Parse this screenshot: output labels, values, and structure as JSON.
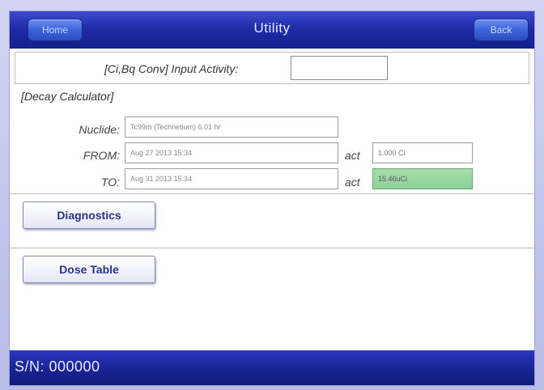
{
  "window": {
    "title": "Utility",
    "home_label": "Home",
    "back_label": "Back"
  },
  "conversion": {
    "label": "[Ci,Bq Conv] Input Activity:",
    "input_value": ""
  },
  "decay": {
    "section_title": "[Decay Calculator]",
    "nuclide_label": "Nuclide:",
    "nuclide_value": "Tc99m (Technetium) 6.01 hr",
    "from_label": "FROM:",
    "from_value": "Aug 27 2013 15:34",
    "to_label": "TO:",
    "to_value": "Aug 31 2013 15:34",
    "act_label": "act",
    "from_act_value": "1.000 Ci",
    "to_act_value": "15.46uCi"
  },
  "buttons": {
    "diagnostics_label": "Diagnostics",
    "dose_table_label": "Dose Table"
  },
  "status": {
    "serial": "S/N: 000000"
  },
  "colors": {
    "titlebar": "#1f2ca8",
    "result_field": "#8fd195",
    "button_text": "#2a3288"
  }
}
